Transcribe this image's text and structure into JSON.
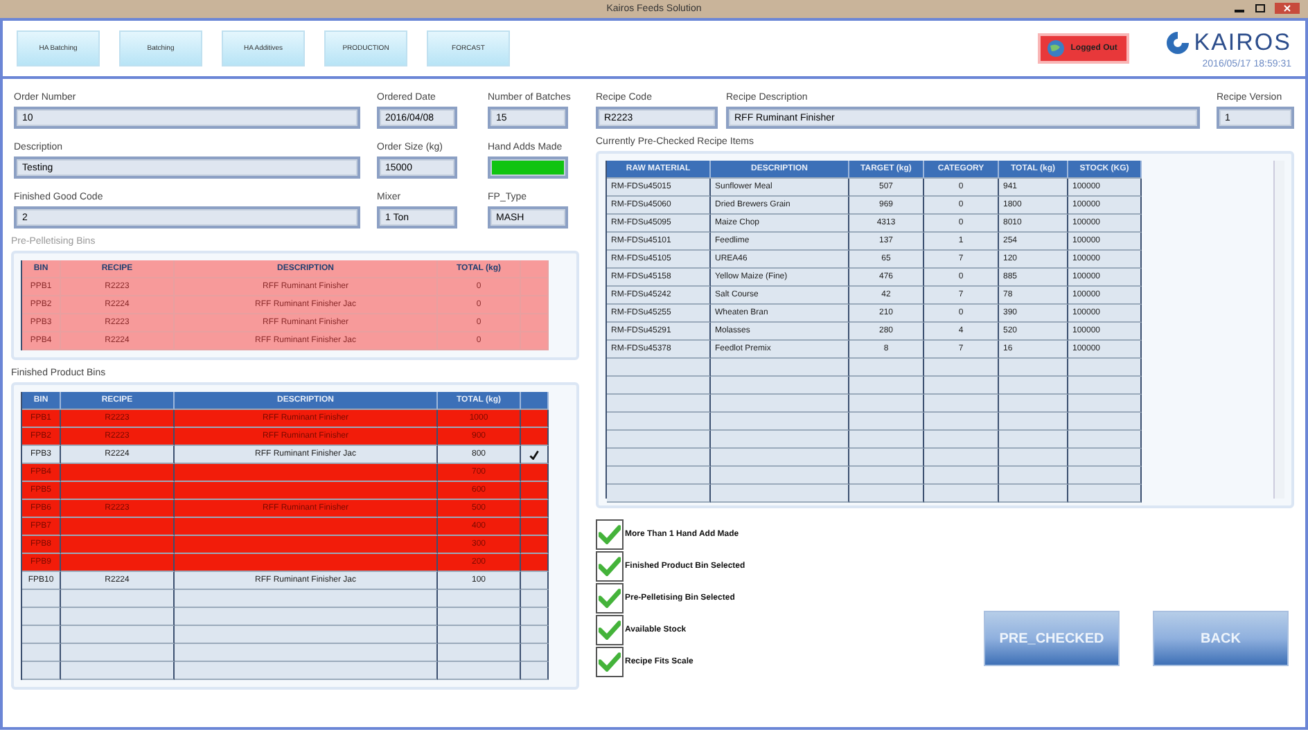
{
  "window": {
    "title": "Kairos Feeds Solution"
  },
  "nav": [
    "HA Batching",
    "Batching",
    "HA Additives",
    "PRODUCTION",
    "FORCAST"
  ],
  "logout": "Logged Out",
  "logo": "KAIROS",
  "datetime": "2016/05/17 18:59:31",
  "order": {
    "fields": [
      {
        "label": "Order Number",
        "value": "10"
      },
      {
        "label": "Ordered Date",
        "value": "2016/04/08"
      },
      {
        "label": "Number of Batches",
        "value": "15"
      },
      {
        "label": "Description",
        "value": "Testing"
      },
      {
        "label": "Order Size (kg)",
        "value": "15000"
      },
      {
        "label": "Hand Adds Made",
        "ok": true
      },
      {
        "label": "Finished Good Code",
        "value": "2"
      },
      {
        "label": "Mixer",
        "value": "1 Ton"
      },
      {
        "label": "FP_Type",
        "value": "MASH"
      }
    ]
  },
  "pre_pelletising": {
    "title": "Pre-Pelletising Bins",
    "disabled": true,
    "columns": [
      "BIN",
      "RECIPE",
      "DESCRIPTION",
      "TOTAL (kg)"
    ],
    "rows": [
      {
        "bin": "PPB1",
        "recipe": "R2223",
        "description": "RFF Ruminant Finisher",
        "total": "0"
      },
      {
        "bin": "PPB2",
        "recipe": "R2224",
        "description": "RFF Ruminant Finisher Jac",
        "total": "0"
      },
      {
        "bin": "PPB3",
        "recipe": "R2223",
        "description": "RFF Ruminant Finisher",
        "total": "0"
      },
      {
        "bin": "PPB4",
        "recipe": "R2224",
        "description": "RFF Ruminant Finisher Jac",
        "total": "0"
      }
    ]
  },
  "finished_product": {
    "title": "Finished Product Bins",
    "disabled": false,
    "columns": [
      "BIN",
      "RECIPE",
      "DESCRIPTION",
      "TOTAL (kg)"
    ],
    "rows": [
      {
        "bin": "FPB1",
        "recipe": "R2223",
        "description": "RFF Ruminant Finisher",
        "total": "1000",
        "blocked": true,
        "checked": false
      },
      {
        "bin": "FPB2",
        "recipe": "R2223",
        "description": "RFF Ruminant Finisher",
        "total": "900",
        "blocked": true,
        "checked": false
      },
      {
        "bin": "FPB3",
        "recipe": "R2224",
        "description": "RFF Ruminant Finisher Jac",
        "total": "800",
        "blocked": false,
        "checked": true
      },
      {
        "bin": "FPB4",
        "total": "700",
        "blocked": true,
        "checked": false
      },
      {
        "bin": "FPB5",
        "total": "600",
        "blocked": true,
        "checked": false
      },
      {
        "bin": "FPB6",
        "recipe": "R2223",
        "description": "RFF Ruminant Finisher",
        "total": "500",
        "blocked": true,
        "checked": false
      },
      {
        "bin": "FPB7",
        "total": "400",
        "blocked": true,
        "checked": false
      },
      {
        "bin": "FPB8",
        "total": "300",
        "blocked": true,
        "checked": false
      },
      {
        "bin": "FPB9",
        "total": "200",
        "blocked": true,
        "checked": false
      },
      {
        "bin": "FPB10",
        "recipe": "R2224",
        "description": "RFF Ruminant Finisher Jac",
        "total": "100",
        "blocked": false,
        "checked": false
      }
    ]
  },
  "recipe": {
    "fields": [
      {
        "label": "Recipe Code",
        "value": "R2223"
      },
      {
        "label": "Recipe Description",
        "value": "RFF Ruminant Finisher"
      },
      {
        "label": "Recipe Version",
        "value": "1"
      }
    ]
  },
  "items": {
    "title": "Currently Pre-Checked Recipe Items",
    "columns": [
      "RAW MATERIAL",
      "DESCRIPTION",
      "TARGET (kg)",
      "CATEGORY",
      "TOTAL (kg)",
      "STOCK (KG)"
    ],
    "rows": [
      [
        "RM-FDSu45015",
        "Sunflower Meal",
        "507",
        "0",
        "941",
        "100000"
      ],
      [
        "RM-FDSu45060",
        "Dried Brewers Grain",
        "969",
        "0",
        "1800",
        "100000"
      ],
      [
        "RM-FDSu45095",
        "Maize Chop",
        "4313",
        "0",
        "8010",
        "100000"
      ],
      [
        "RM-FDSu45101",
        "Feedlime",
        "137",
        "1",
        "254",
        "100000"
      ],
      [
        "RM-FDSu45105",
        "UREA46",
        "65",
        "7",
        "120",
        "100000"
      ],
      [
        "RM-FDSu45158",
        "Yellow Maize (Fine)",
        "476",
        "0",
        "885",
        "100000"
      ],
      [
        "RM-FDSu45242",
        "Salt Course",
        "42",
        "7",
        "78",
        "100000"
      ],
      [
        "RM-FDSu45255",
        "Wheaten Bran",
        "210",
        "0",
        "390",
        "100000"
      ],
      [
        "RM-FDSu45291",
        "Molasses",
        "280",
        "4",
        "520",
        "100000"
      ],
      [
        "RM-FDSu45378",
        "Feedlot Premix",
        "8",
        "7",
        "16",
        "100000"
      ]
    ]
  },
  "checks": [
    {
      "label": "More Than 1 Hand Add Made",
      "checked": true
    },
    {
      "label": "Finished Product Bin Selected",
      "checked": true
    },
    {
      "label": "Pre-Pelletising Bin Selected",
      "checked": true
    },
    {
      "label": "Available Stock",
      "checked": true
    },
    {
      "label": "Recipe Fits Scale",
      "checked": true
    }
  ],
  "buttons": [
    "PRE_CHECKED",
    "BACK"
  ]
}
